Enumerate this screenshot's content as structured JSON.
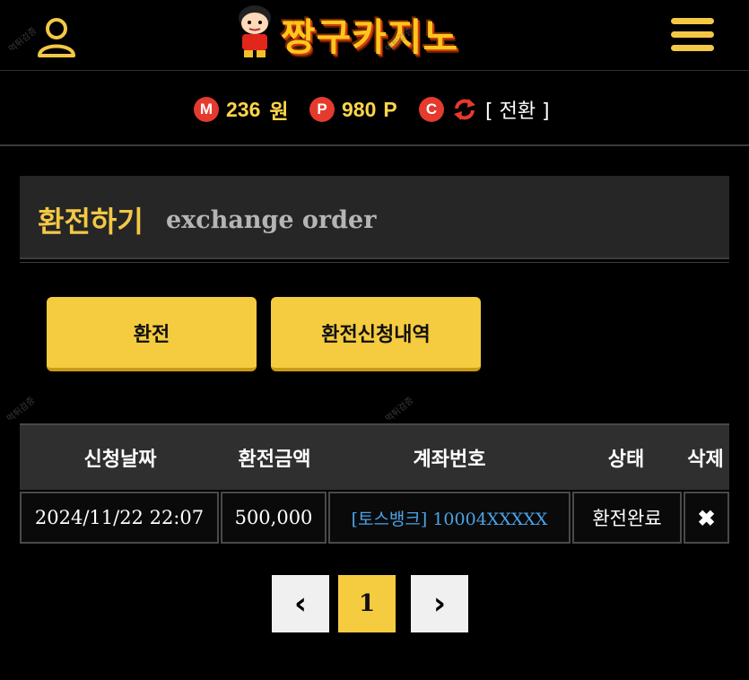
{
  "header": {
    "logo_text": "짱구카지노",
    "watermark": "먹튀검증"
  },
  "balances": {
    "money_badge": "M",
    "money_value": "236",
    "money_unit": "원",
    "point_badge": "P",
    "point_value": "980",
    "point_unit": "P",
    "casino_badge": "C",
    "switch_label": "[ 전환 ]"
  },
  "panel": {
    "title": "환전하기",
    "subtitle": "exchange order"
  },
  "buttons": {
    "exchange": "환전",
    "history": "환전신청내역"
  },
  "table": {
    "headers": [
      "신청날짜",
      "환전금액",
      "계좌번호",
      "상태",
      "삭제"
    ],
    "rows": [
      {
        "date": "2024/11/22 22:07",
        "amount": "500,000",
        "account": "[토스뱅크] 10004XXXXX",
        "status": "환전완료",
        "delete": "✖"
      }
    ]
  },
  "pagination": {
    "prev": "‹",
    "current": "1",
    "next": "›"
  },
  "colors": {
    "accent": "#f5cb3f",
    "badge": "#e53a2e",
    "balance_text": "#ffd54a",
    "link": "#4aa3e8"
  }
}
